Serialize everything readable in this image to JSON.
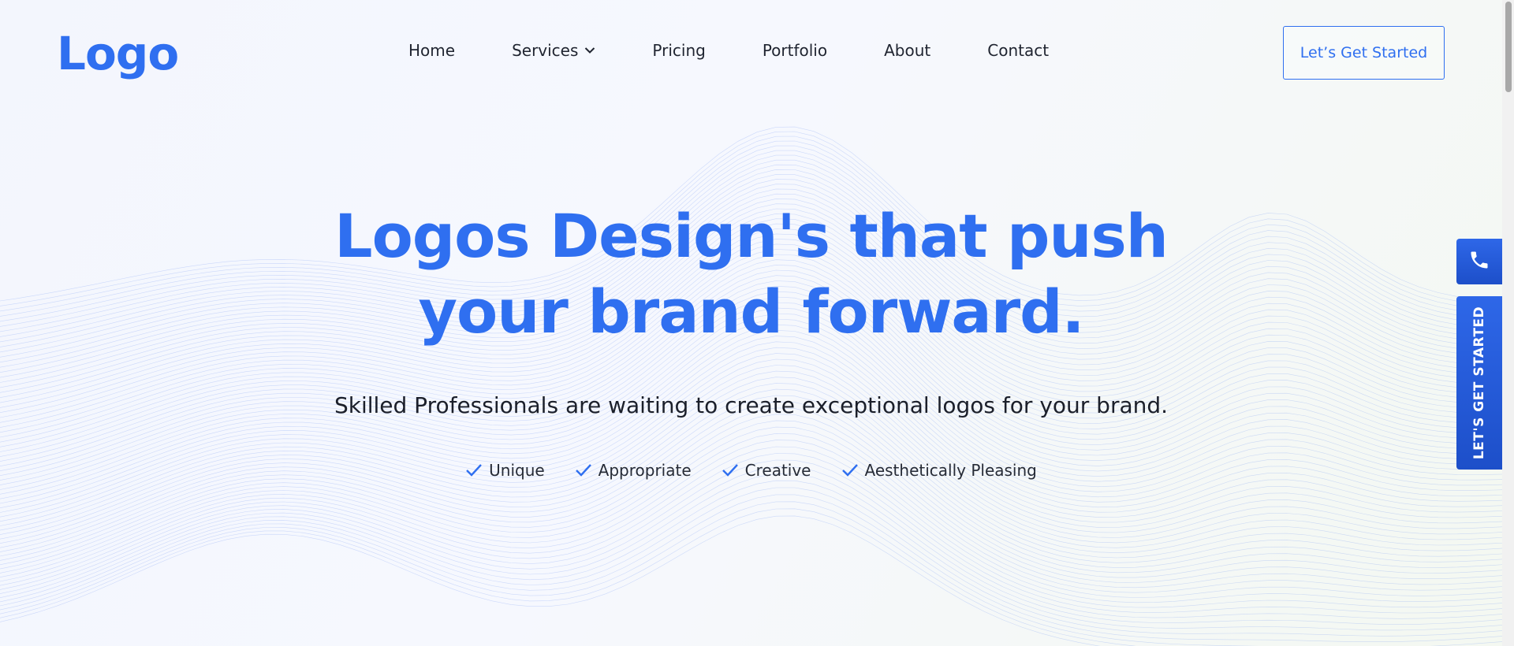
{
  "header": {
    "logo_text": "Logo",
    "nav": [
      {
        "label": "Home"
      },
      {
        "label": "Services",
        "has_dropdown": true
      },
      {
        "label": "Pricing"
      },
      {
        "label": "Portfolio"
      },
      {
        "label": "About"
      },
      {
        "label": "Contact"
      }
    ],
    "cta_label": "Let’s Get Started"
  },
  "hero": {
    "title_line1": "Logos Design's that push",
    "title_line2": "your brand forward.",
    "subtitle": "Skilled Professionals are waiting to create exceptional logos for your brand.",
    "features": [
      "Unique",
      "Appropriate",
      "Creative",
      "Aesthetically Pleasing"
    ]
  },
  "side_widget": {
    "phone_icon": "phone-icon",
    "cta_label": "LET'S GET STARTED"
  },
  "colors": {
    "brand_blue": "#2f6ff0",
    "sidebar_blue": "#1d4fc9",
    "text_dark": "#1b1f2a"
  }
}
